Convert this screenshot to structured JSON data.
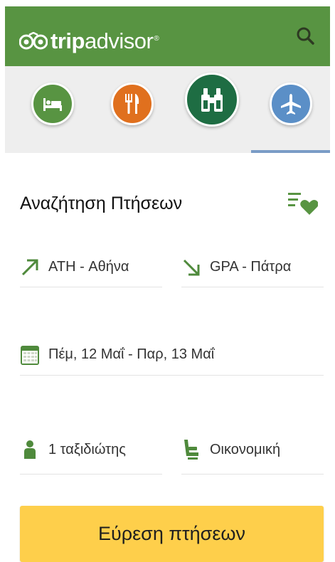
{
  "brand": {
    "logo_word_bold": "trip",
    "logo_word_light": "advisor",
    "registered_mark": "®"
  },
  "colors": {
    "appbar": "#589442",
    "hotels": "#589442",
    "restaurants": "#e0701e",
    "attractions": "#1e6d43",
    "flights": "#5b8fc7",
    "cta": "#fecf4b"
  },
  "header": {
    "search_icon": "search-icon"
  },
  "categories": [
    {
      "name": "hotels",
      "icon": "bed-icon",
      "selected": false
    },
    {
      "name": "restaurants",
      "icon": "fork-knife-icon",
      "selected": false
    },
    {
      "name": "attractions",
      "icon": "binoculars-icon",
      "selected": false
    },
    {
      "name": "flights",
      "icon": "airplane-icon",
      "selected": true
    }
  ],
  "flight_search": {
    "title": "Αναζήτηση Πτήσεων",
    "favorites_icon": "list-heart-icon",
    "origin": {
      "icon": "arrow-up-right-icon",
      "value": "ATH - Αθήνα"
    },
    "destination": {
      "icon": "arrow-down-right-icon",
      "value": "GPA - Πάτρα"
    },
    "dates": {
      "icon": "calendar-icon",
      "value": "Πέμ, 12 Μαΐ - Παρ, 13 Μαΐ"
    },
    "travelers": {
      "icon": "person-icon",
      "value": "1 ταξιδιώτης"
    },
    "cabin_class": {
      "icon": "seat-icon",
      "value": "Οικονομική"
    },
    "submit_label": "Εύρεση πτήσεων"
  }
}
